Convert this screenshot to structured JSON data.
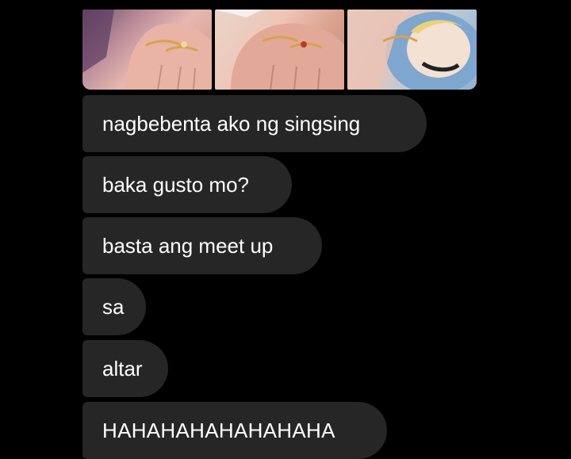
{
  "conversation": {
    "photos": [
      {
        "name": "ring-photo-1",
        "subject": "hand with rings"
      },
      {
        "name": "ring-photo-2",
        "subject": "hand with rings"
      },
      {
        "name": "ring-photo-3",
        "subject": "ring on card"
      }
    ],
    "messages": [
      {
        "text": "nagbebenta ako ng singsing"
      },
      {
        "text": "baka gusto mo?"
      },
      {
        "text": "basta ang meet up"
      },
      {
        "text": "sa"
      },
      {
        "text": "altar"
      },
      {
        "text": "HAHAHAHAHAHAHAHA"
      }
    ],
    "colors": {
      "background": "#000000",
      "bubble": "#262626",
      "text": "#ffffff"
    }
  }
}
